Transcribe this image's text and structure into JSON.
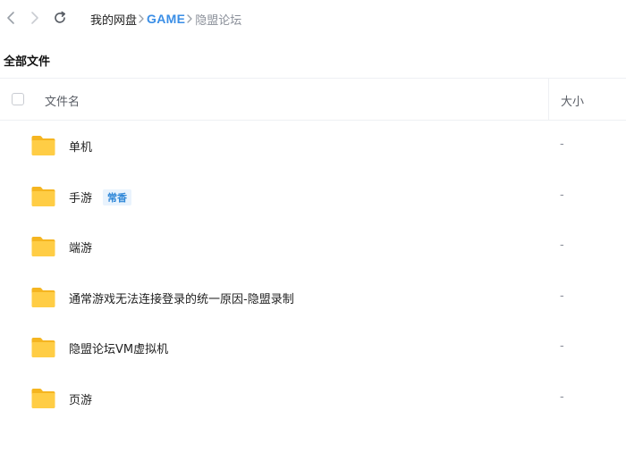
{
  "toolbar": {
    "back_icon": "chevron-left-icon",
    "forward_icon": "chevron-right-icon",
    "refresh_icon": "refresh-icon"
  },
  "breadcrumb": {
    "items": [
      "我的网盘",
      "GAME",
      "隐盟论坛"
    ],
    "separator_icon": "chevron-right-icon"
  },
  "section": {
    "title": "全部文件"
  },
  "table": {
    "columns": {
      "name": "文件名",
      "size": "大小"
    },
    "rows": [
      {
        "name": "单机",
        "tag": "",
        "size": "-",
        "icon": "folder-icon"
      },
      {
        "name": "手游",
        "tag": "常香",
        "size": "-",
        "icon": "folder-icon"
      },
      {
        "name": "端游",
        "tag": "",
        "size": "-",
        "icon": "folder-icon"
      },
      {
        "name": "通常游戏无法连接登录的统一原因-隐盟录制",
        "tag": "",
        "size": "-",
        "icon": "folder-icon"
      },
      {
        "name": "隐盟论坛VM虚拟机",
        "tag": "",
        "size": "-",
        "icon": "folder-icon"
      },
      {
        "name": "页游",
        "tag": "",
        "size": "-",
        "icon": "folder-icon"
      }
    ]
  },
  "colors": {
    "accent": "#3a8ee6",
    "folder": "#ffc83d",
    "folder_back": "#f5b520",
    "tag_bg": "#e9f3fd"
  }
}
